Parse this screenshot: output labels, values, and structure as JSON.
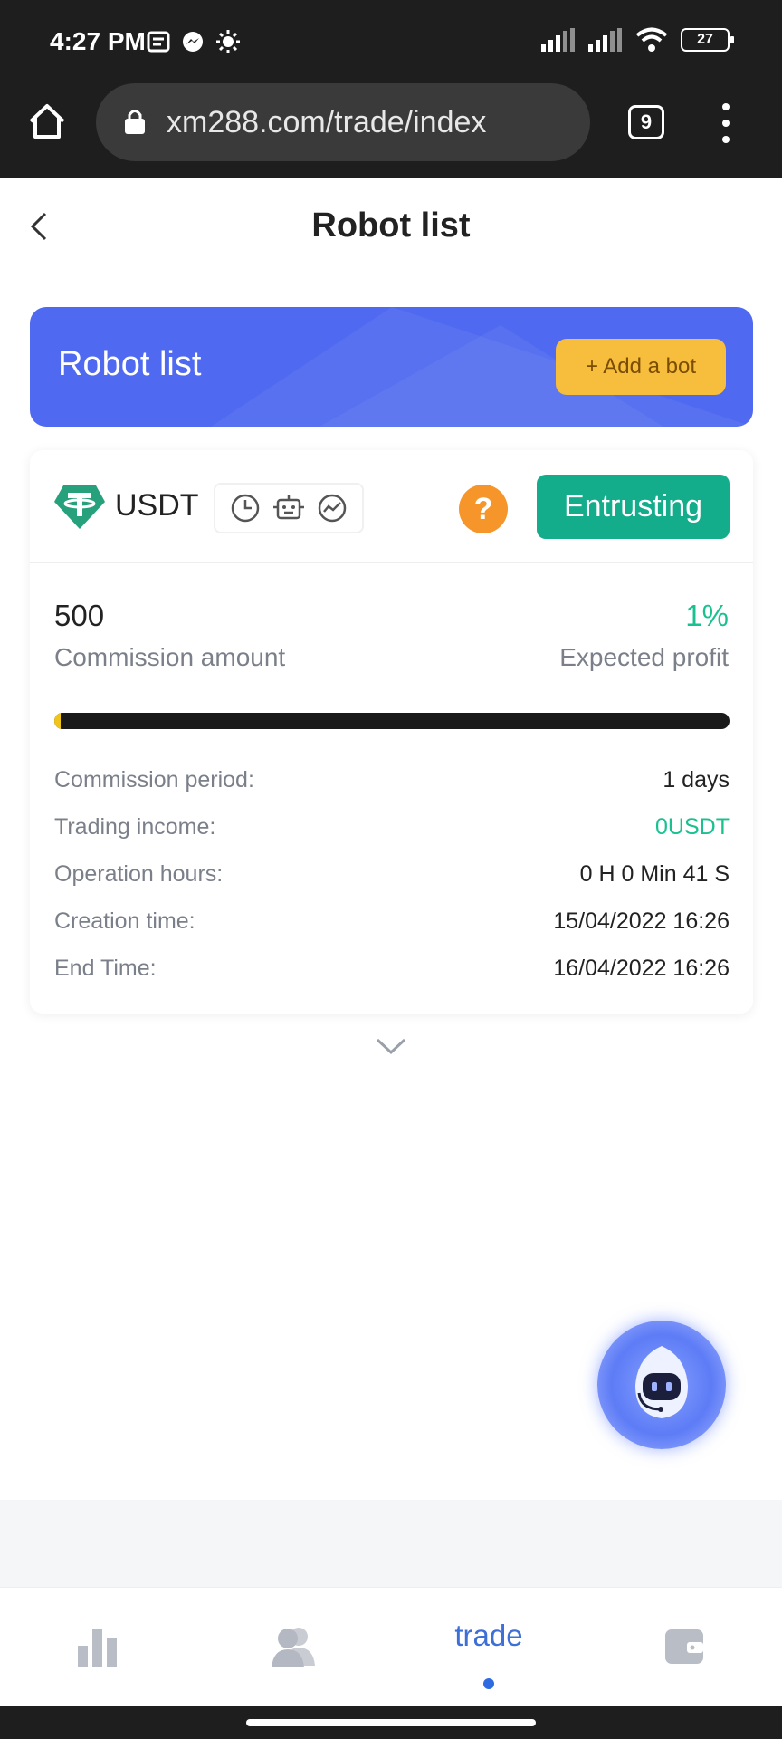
{
  "status_bar": {
    "time": "4:27 PM",
    "battery": "27"
  },
  "browser": {
    "url": "xm288.com/trade/index",
    "tab_count": "9"
  },
  "header": {
    "title": "Robot list"
  },
  "banner": {
    "title": "Robot list",
    "add_bot_label": "+ Add a bot",
    "color": "#4f6af0"
  },
  "robot_card": {
    "coin": "USDT",
    "status_label": "Entrusting",
    "help_label": "?",
    "commission_amount": "500",
    "commission_amount_label": "Commission amount",
    "expected_profit": "1%",
    "expected_profit_label": "Expected profit",
    "progress_fraction": 0.01,
    "rows": [
      {
        "label": "Commission period:",
        "value": "1 days"
      },
      {
        "label": "Trading income:",
        "value": "0USDT"
      },
      {
        "label": "Operation hours:",
        "value": "0 H 0 Min 41 S"
      },
      {
        "label": "Creation time:",
        "value": "15/04/2022 16:26"
      },
      {
        "label": "End Time:",
        "value": "16/04/2022 16:26"
      }
    ]
  },
  "bottom_nav": {
    "items": [
      {
        "icon": "bar-chart-icon",
        "label": ""
      },
      {
        "icon": "users-icon",
        "label": ""
      },
      {
        "icon": "",
        "label": "trade",
        "active": true
      },
      {
        "icon": "wallet-icon",
        "label": ""
      }
    ]
  },
  "colors": {
    "accent": "#4f6af0",
    "status_green": "#13ad8c",
    "profit_green": "#19c191",
    "button_yellow": "#f7bd3c",
    "nav_active": "#3d6fd6"
  }
}
